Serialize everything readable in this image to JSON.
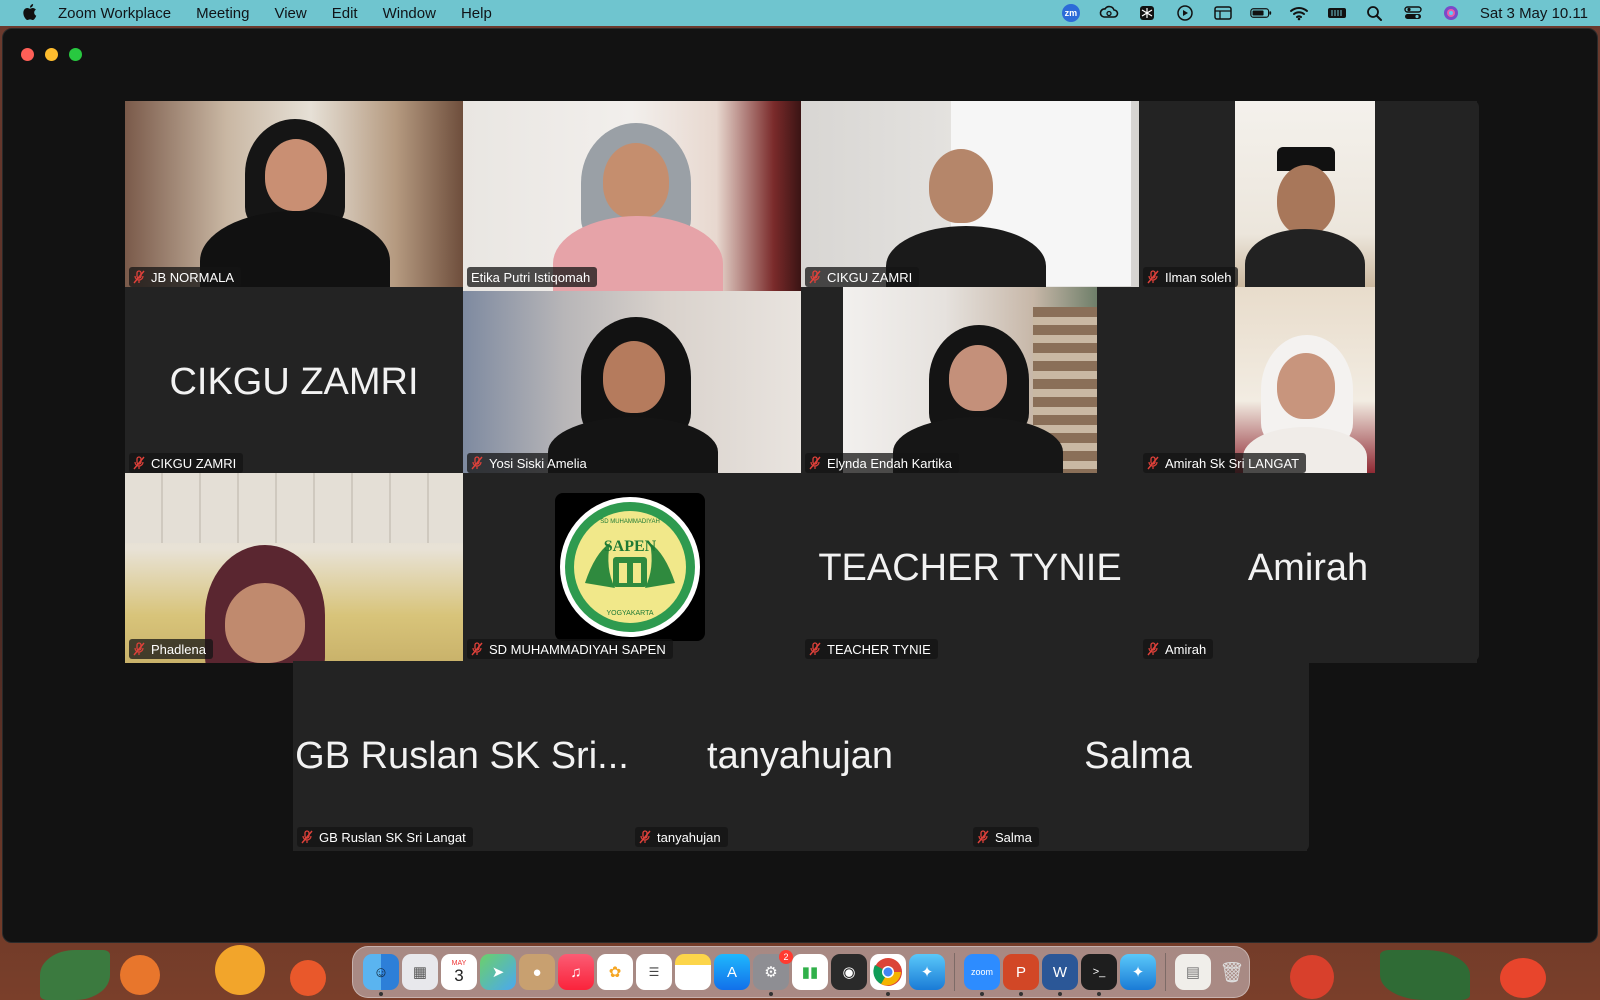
{
  "menubar": {
    "app_name": "Zoom Workplace",
    "items": [
      "Meeting",
      "View",
      "Edit",
      "Window",
      "Help"
    ],
    "zoom_badge": "zm",
    "clock": "Sat 3 May  10.11"
  },
  "tiles": [
    {
      "name": "JB NORMALA",
      "muted": true,
      "video": true
    },
    {
      "name": "Etika Putri Istiqomah",
      "muted": false,
      "video": true,
      "active_speaker": true
    },
    {
      "name": "CIKGU ZAMRI",
      "muted": true,
      "video": true
    },
    {
      "name": "Ilman soleh",
      "muted": true,
      "video": true
    },
    {
      "name": "CIKGU ZAMRI",
      "muted": true,
      "video": false,
      "display_name": "CIKGU ZAMRI"
    },
    {
      "name": "Yosi Siski Amelia",
      "muted": true,
      "video": true
    },
    {
      "name": "Elynda Endah Kartika",
      "muted": true,
      "video": true
    },
    {
      "name": "Amirah Sk Sri LANGAT",
      "muted": true,
      "video": true
    },
    {
      "name": "Phadlena",
      "muted": true,
      "video": true
    },
    {
      "name": "SD MUHAMMADIYAH SAPEN",
      "muted": true,
      "video": false,
      "logo": true
    },
    {
      "name": "TEACHER TYNIE",
      "muted": true,
      "video": false,
      "display_name": "TEACHER TYNIE"
    },
    {
      "name": "Amirah",
      "muted": true,
      "video": false,
      "display_name": "Amirah"
    },
    {
      "name": "GB Ruslan SK Sri Langat",
      "muted": true,
      "video": false,
      "display_name": "GB Ruslan SK Sri..."
    },
    {
      "name": "tanyahujan",
      "muted": true,
      "video": false,
      "display_name": "tanyahujan"
    },
    {
      "name": "Salma",
      "muted": true,
      "video": false,
      "display_name": "Salma"
    }
  ],
  "logo": {
    "top_text": "SD MUHAMMADIYAH",
    "main_text": "SAPEN",
    "bottom_text": "YOGYAKARTA"
  },
  "dock": {
    "calendar_month": "MAY",
    "calendar_day": "3",
    "settings_badge": "2",
    "zoom_label": "zoom"
  },
  "colors": {
    "menubar": "#6fc5cf",
    "window_bg": "#121212",
    "tile_bg": "#232323",
    "active_speaker_border": "#2ad64c",
    "mute_red": "#e0413a"
  }
}
